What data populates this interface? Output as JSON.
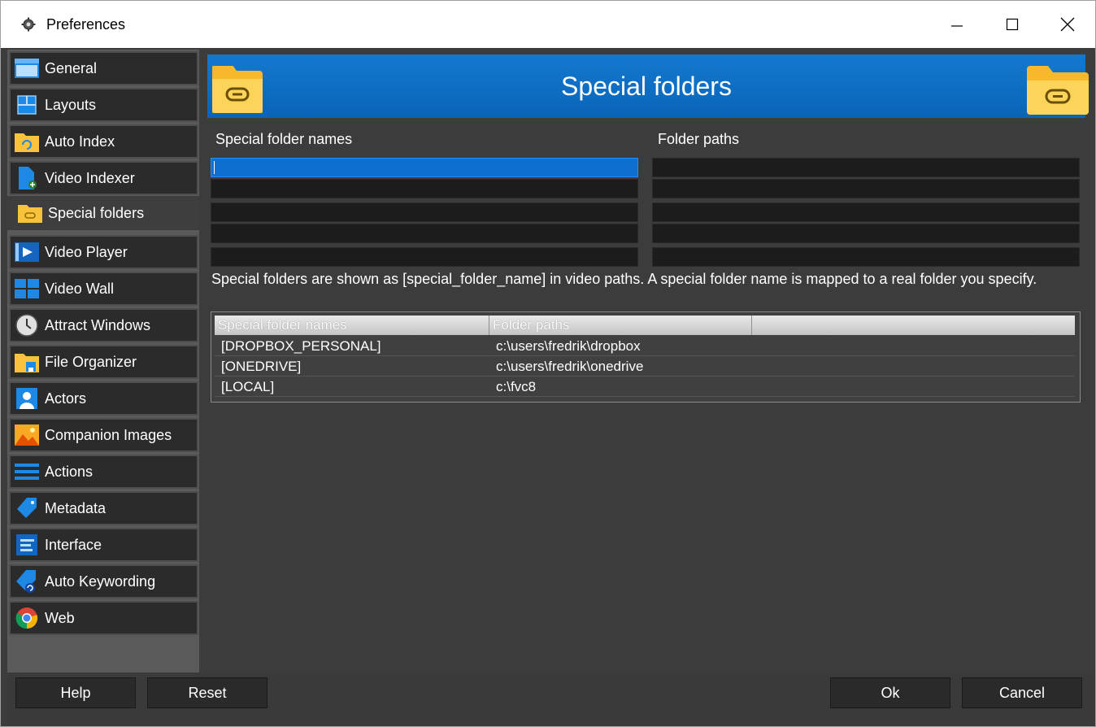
{
  "window": {
    "title": "Preferences"
  },
  "title_controls": {
    "minimize": "—",
    "maximize": "☐",
    "close": "✕"
  },
  "sidebar": {
    "items": [
      {
        "label": "General",
        "icon": "window-icon"
      },
      {
        "label": "Layouts",
        "icon": "layout-icon"
      },
      {
        "label": "Auto Index",
        "icon": "folder-sync-icon"
      },
      {
        "label": "Video Indexer",
        "icon": "file-add-icon"
      },
      {
        "label": "Special folders",
        "icon": "folder-link-icon",
        "active": true
      },
      {
        "label": "Video Player",
        "icon": "video-player-icon"
      },
      {
        "label": "Video Wall",
        "icon": "video-wall-icon"
      },
      {
        "label": "Attract Windows",
        "icon": "clock-icon"
      },
      {
        "label": "File Organizer",
        "icon": "folder-save-icon"
      },
      {
        "label": "Actors",
        "icon": "person-icon"
      },
      {
        "label": "Companion Images",
        "icon": "image-icon"
      },
      {
        "label": "Actions",
        "icon": "list-lines-icon"
      },
      {
        "label": "Metadata",
        "icon": "tag-icon"
      },
      {
        "label": "Interface",
        "icon": "interface-icon"
      },
      {
        "label": "Auto Keywording",
        "icon": "tag-refresh-icon"
      },
      {
        "label": "Web",
        "icon": "chrome-icon"
      }
    ]
  },
  "main": {
    "banner_title": "Special folders",
    "names_label": "Special folder names",
    "paths_label": "Folder paths",
    "name_fields": [
      "",
      "",
      "",
      "",
      ""
    ],
    "path_fields": [
      "",
      "",
      "",
      "",
      ""
    ],
    "info_text": "Special folders are shown as [special_folder_name] in video paths. A special folder name is mapped to a real folder you specify.",
    "table": {
      "columns": [
        "Special folder names",
        "Folder paths",
        ""
      ],
      "rows": [
        [
          "[DROPBOX_PERSONAL]",
          "c:\\users\\fredrik\\dropbox"
        ],
        [
          "[ONEDRIVE]",
          "c:\\users\\fredrik\\onedrive"
        ],
        [
          "[LOCAL]",
          "c:\\fvc8"
        ]
      ]
    }
  },
  "buttons": {
    "help": "Help",
    "reset": "Reset",
    "ok": "Ok",
    "cancel": "Cancel"
  },
  "colors": {
    "accent": "#0a64b8",
    "panel": "#3c3c3c",
    "sidebar_item": "#2b2b2b"
  }
}
